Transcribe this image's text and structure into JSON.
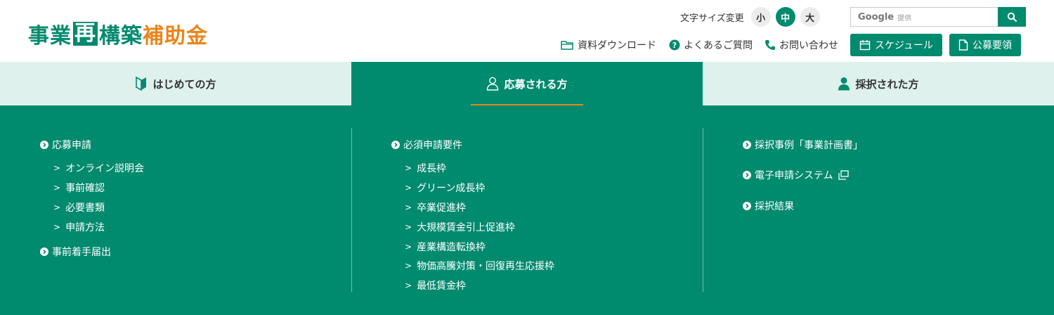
{
  "logo": {
    "part1": "事業",
    "part2": "再",
    "part3": "構築",
    "part4": "補助金"
  },
  "font_size": {
    "label": "文字サイズ変更",
    "small": "小",
    "medium": "中",
    "large": "大"
  },
  "search": {
    "google": "Google",
    "provided": "提供",
    "placeholder": ""
  },
  "utility_links": {
    "download": "資料ダウンロード",
    "faq": "よくあるご質問",
    "contact": "お問い合わせ"
  },
  "buttons": {
    "schedule": "スケジュール",
    "guidelines": "公募要領"
  },
  "tabs": [
    {
      "label": "はじめての方"
    },
    {
      "label": "応募される方"
    },
    {
      "label": "採択された方"
    }
  ],
  "menu": {
    "col1": {
      "sections": [
        {
          "title": "応募申請",
          "items": [
            "オンライン説明会",
            "事前確認",
            "必要書類",
            "申請方法"
          ]
        },
        {
          "title": "事前着手届出",
          "items": []
        }
      ]
    },
    "col2": {
      "sections": [
        {
          "title": "必須申請要件",
          "items": [
            "成長枠",
            "グリーン成長枠",
            "卒業促進枠",
            "大規模賃金引上促進枠",
            "産業構造転換枠",
            "物価高騰対策・回復再生応援枠",
            "最低賃金枠"
          ]
        }
      ]
    },
    "col3": {
      "sections": [
        {
          "title": "採択事例「事業計画書」"
        },
        {
          "title": "電子申請システム"
        },
        {
          "title": "採択結果"
        }
      ]
    }
  },
  "colors": {
    "brand_green": "#008a6e",
    "accent_orange": "#e9861e",
    "tab_light": "#dff1ed"
  }
}
